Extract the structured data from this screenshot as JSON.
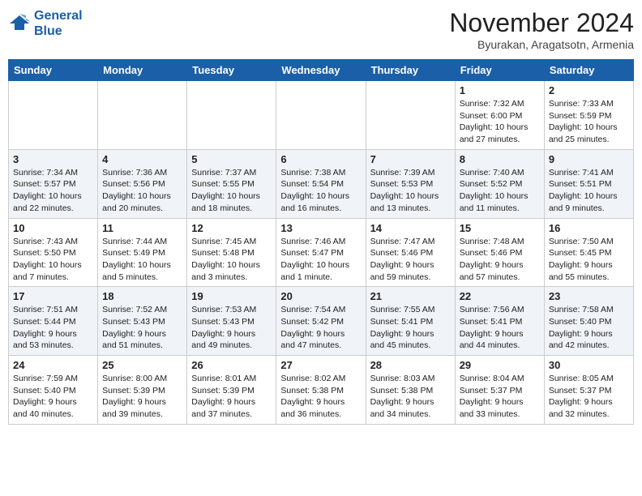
{
  "header": {
    "logo_line1": "General",
    "logo_line2": "Blue",
    "month": "November 2024",
    "location": "Byurakan, Aragatsotn, Armenia"
  },
  "weekdays": [
    "Sunday",
    "Monday",
    "Tuesday",
    "Wednesday",
    "Thursday",
    "Friday",
    "Saturday"
  ],
  "weeks": [
    [
      {
        "day": "",
        "info": ""
      },
      {
        "day": "",
        "info": ""
      },
      {
        "day": "",
        "info": ""
      },
      {
        "day": "",
        "info": ""
      },
      {
        "day": "",
        "info": ""
      },
      {
        "day": "1",
        "info": "Sunrise: 7:32 AM\nSunset: 6:00 PM\nDaylight: 10 hours and 27 minutes."
      },
      {
        "day": "2",
        "info": "Sunrise: 7:33 AM\nSunset: 5:59 PM\nDaylight: 10 hours and 25 minutes."
      }
    ],
    [
      {
        "day": "3",
        "info": "Sunrise: 7:34 AM\nSunset: 5:57 PM\nDaylight: 10 hours and 22 minutes."
      },
      {
        "day": "4",
        "info": "Sunrise: 7:36 AM\nSunset: 5:56 PM\nDaylight: 10 hours and 20 minutes."
      },
      {
        "day": "5",
        "info": "Sunrise: 7:37 AM\nSunset: 5:55 PM\nDaylight: 10 hours and 18 minutes."
      },
      {
        "day": "6",
        "info": "Sunrise: 7:38 AM\nSunset: 5:54 PM\nDaylight: 10 hours and 16 minutes."
      },
      {
        "day": "7",
        "info": "Sunrise: 7:39 AM\nSunset: 5:53 PM\nDaylight: 10 hours and 13 minutes."
      },
      {
        "day": "8",
        "info": "Sunrise: 7:40 AM\nSunset: 5:52 PM\nDaylight: 10 hours and 11 minutes."
      },
      {
        "day": "9",
        "info": "Sunrise: 7:41 AM\nSunset: 5:51 PM\nDaylight: 10 hours and 9 minutes."
      }
    ],
    [
      {
        "day": "10",
        "info": "Sunrise: 7:43 AM\nSunset: 5:50 PM\nDaylight: 10 hours and 7 minutes."
      },
      {
        "day": "11",
        "info": "Sunrise: 7:44 AM\nSunset: 5:49 PM\nDaylight: 10 hours and 5 minutes."
      },
      {
        "day": "12",
        "info": "Sunrise: 7:45 AM\nSunset: 5:48 PM\nDaylight: 10 hours and 3 minutes."
      },
      {
        "day": "13",
        "info": "Sunrise: 7:46 AM\nSunset: 5:47 PM\nDaylight: 10 hours and 1 minute."
      },
      {
        "day": "14",
        "info": "Sunrise: 7:47 AM\nSunset: 5:46 PM\nDaylight: 9 hours and 59 minutes."
      },
      {
        "day": "15",
        "info": "Sunrise: 7:48 AM\nSunset: 5:46 PM\nDaylight: 9 hours and 57 minutes."
      },
      {
        "day": "16",
        "info": "Sunrise: 7:50 AM\nSunset: 5:45 PM\nDaylight: 9 hours and 55 minutes."
      }
    ],
    [
      {
        "day": "17",
        "info": "Sunrise: 7:51 AM\nSunset: 5:44 PM\nDaylight: 9 hours and 53 minutes."
      },
      {
        "day": "18",
        "info": "Sunrise: 7:52 AM\nSunset: 5:43 PM\nDaylight: 9 hours and 51 minutes."
      },
      {
        "day": "19",
        "info": "Sunrise: 7:53 AM\nSunset: 5:43 PM\nDaylight: 9 hours and 49 minutes."
      },
      {
        "day": "20",
        "info": "Sunrise: 7:54 AM\nSunset: 5:42 PM\nDaylight: 9 hours and 47 minutes."
      },
      {
        "day": "21",
        "info": "Sunrise: 7:55 AM\nSunset: 5:41 PM\nDaylight: 9 hours and 45 minutes."
      },
      {
        "day": "22",
        "info": "Sunrise: 7:56 AM\nSunset: 5:41 PM\nDaylight: 9 hours and 44 minutes."
      },
      {
        "day": "23",
        "info": "Sunrise: 7:58 AM\nSunset: 5:40 PM\nDaylight: 9 hours and 42 minutes."
      }
    ],
    [
      {
        "day": "24",
        "info": "Sunrise: 7:59 AM\nSunset: 5:40 PM\nDaylight: 9 hours and 40 minutes."
      },
      {
        "day": "25",
        "info": "Sunrise: 8:00 AM\nSunset: 5:39 PM\nDaylight: 9 hours and 39 minutes."
      },
      {
        "day": "26",
        "info": "Sunrise: 8:01 AM\nSunset: 5:39 PM\nDaylight: 9 hours and 37 minutes."
      },
      {
        "day": "27",
        "info": "Sunrise: 8:02 AM\nSunset: 5:38 PM\nDaylight: 9 hours and 36 minutes."
      },
      {
        "day": "28",
        "info": "Sunrise: 8:03 AM\nSunset: 5:38 PM\nDaylight: 9 hours and 34 minutes."
      },
      {
        "day": "29",
        "info": "Sunrise: 8:04 AM\nSunset: 5:37 PM\nDaylight: 9 hours and 33 minutes."
      },
      {
        "day": "30",
        "info": "Sunrise: 8:05 AM\nSunset: 5:37 PM\nDaylight: 9 hours and 32 minutes."
      }
    ]
  ]
}
